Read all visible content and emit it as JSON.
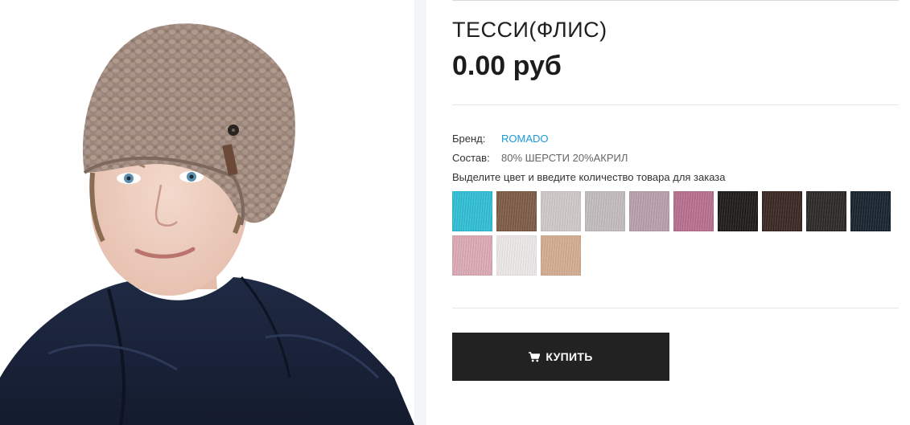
{
  "product": {
    "title": "ТЕССИ(ФЛИС)",
    "price": "0.00 руб",
    "brand_label": "Бренд:",
    "brand_value": "ROMADO",
    "composition_label": "Состав:",
    "composition_value": "80% ШЕРСТИ 20%АКРИЛ",
    "instruction": "Выделите цвет и введите количество товара для заказа",
    "buy_label": "КУПИТЬ",
    "buy_icon": "cart-icon",
    "photo_alt": "product-photo"
  },
  "swatches": [
    {
      "color": "#2fbfd6"
    },
    {
      "color": "#7d5b46"
    },
    {
      "color": "#cfc9c8"
    },
    {
      "color": "#c2bcbd"
    },
    {
      "color": "#b9a0aa"
    },
    {
      "color": "#b86f8f"
    },
    {
      "color": "#1e1a1a"
    },
    {
      "color": "#3a2622"
    },
    {
      "color": "#2b2827"
    },
    {
      "color": "#17222d"
    },
    {
      "color": "#dcaab5"
    },
    {
      "color": "#ede9e8"
    },
    {
      "color": "#d3ad91"
    }
  ],
  "colors": {
    "accent_link": "#1a9ad6",
    "button_bg": "#222222",
    "button_text": "#ffffff"
  }
}
